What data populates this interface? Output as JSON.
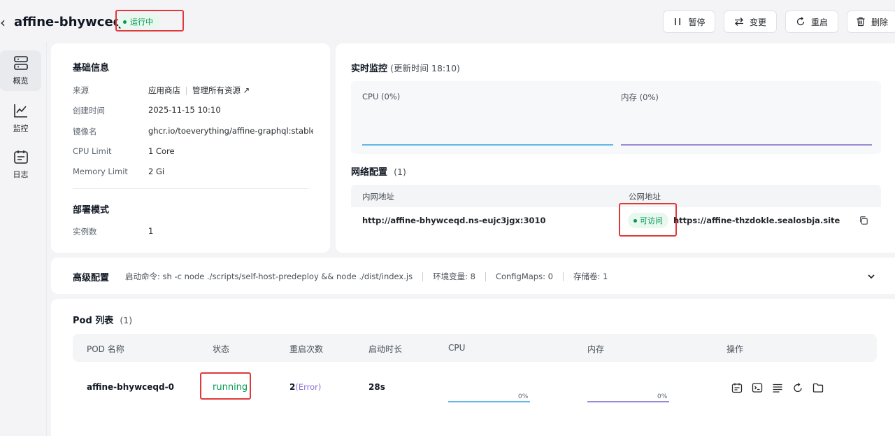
{
  "header": {
    "app_name": "affine-bhywceqd",
    "status": "运行中",
    "buttons": {
      "pause": "暂停",
      "change": "变更",
      "restart": "重启",
      "delete": "删除"
    }
  },
  "sidebar": {
    "items": [
      {
        "label": "概览",
        "icon": "overview-icon",
        "active": true
      },
      {
        "label": "监控",
        "icon": "chart-icon"
      },
      {
        "label": "日志",
        "icon": "calendar-log-icon"
      }
    ]
  },
  "basic_info": {
    "title": "基础信息",
    "rows": [
      {
        "label": "来源",
        "value": "应用商店",
        "link": "管理所有资源"
      },
      {
        "label": "创建时间",
        "value": "2025-11-15 10:10"
      },
      {
        "label": "镜像名",
        "value": "ghcr.io/toeverything/affine-graphql:stable..."
      },
      {
        "label": "CPU Limit",
        "value": "1 Core"
      },
      {
        "label": "Memory Limit",
        "value": "2 Gi"
      }
    ],
    "deploy": {
      "title": "部署模式",
      "label": "实例数",
      "value": "1"
    }
  },
  "monitor": {
    "title": "实时监控",
    "update_label": "(更新时间 18:10)",
    "cpu_label": "CPU (0%)",
    "mem_label": "内存 (0%)",
    "cpu_color": "#62b8e6",
    "mem_color": "#9a8ad8"
  },
  "network": {
    "title": "网络配置",
    "count": "(1)",
    "col_internal": "内网地址",
    "col_public": "公网地址",
    "internal_url": "http://affine-bhywceqd.ns-eujc3jgx:3010",
    "status": "可访问",
    "public_url": "https://affine-thzdokle.sealosbja.site"
  },
  "advanced": {
    "title": "高级配置",
    "command": "启动命令: sh -c node ./scripts/self-host-predeploy && node ./dist/index.js",
    "env": "环境变量: 8",
    "configmaps": "ConfigMaps: 0",
    "storage": "存储卷: 1"
  },
  "pods": {
    "title": "Pod 列表",
    "count": "(1)",
    "columns": [
      "POD 名称",
      "状态",
      "重启次数",
      "启动时长",
      "CPU",
      "内存",
      "操作"
    ],
    "rows": [
      {
        "name": "affine-bhywceqd-0",
        "status": "running",
        "restarts": "2",
        "restart_note": "(Error)",
        "uptime": "28s",
        "cpu_pct": "0%",
        "mem_pct": "0%"
      }
    ]
  },
  "colors": {
    "accent_green": "#039855",
    "highlight_red": "#e0393a",
    "error_purple": "#8b6fd6"
  }
}
